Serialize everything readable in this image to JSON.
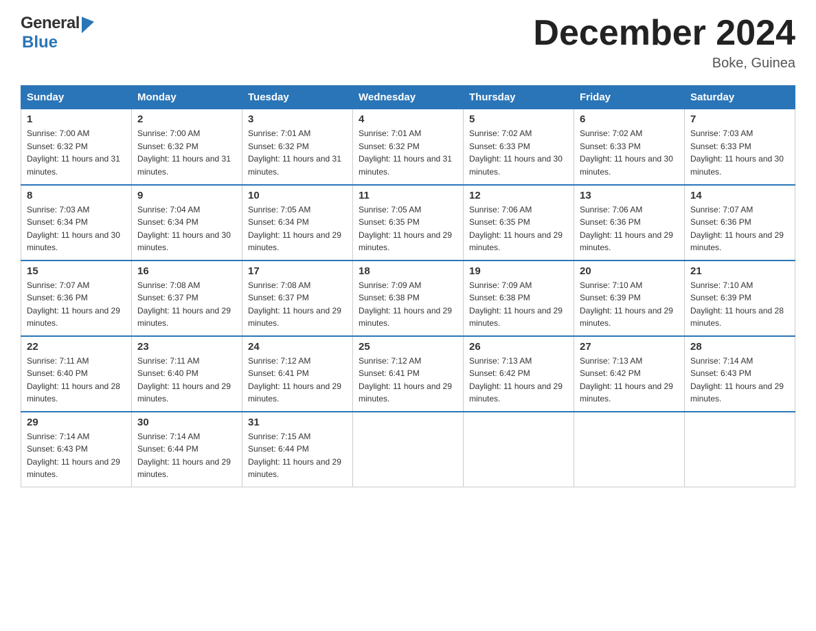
{
  "header": {
    "logo_general": "General",
    "logo_blue": "Blue",
    "month_title": "December 2024",
    "location": "Boke, Guinea"
  },
  "days_of_week": [
    "Sunday",
    "Monday",
    "Tuesday",
    "Wednesday",
    "Thursday",
    "Friday",
    "Saturday"
  ],
  "weeks": [
    [
      {
        "day": "1",
        "sunrise": "7:00 AM",
        "sunset": "6:32 PM",
        "daylight": "11 hours and 31 minutes."
      },
      {
        "day": "2",
        "sunrise": "7:00 AM",
        "sunset": "6:32 PM",
        "daylight": "11 hours and 31 minutes."
      },
      {
        "day": "3",
        "sunrise": "7:01 AM",
        "sunset": "6:32 PM",
        "daylight": "11 hours and 31 minutes."
      },
      {
        "day": "4",
        "sunrise": "7:01 AM",
        "sunset": "6:32 PM",
        "daylight": "11 hours and 31 minutes."
      },
      {
        "day": "5",
        "sunrise": "7:02 AM",
        "sunset": "6:33 PM",
        "daylight": "11 hours and 30 minutes."
      },
      {
        "day": "6",
        "sunrise": "7:02 AM",
        "sunset": "6:33 PM",
        "daylight": "11 hours and 30 minutes."
      },
      {
        "day": "7",
        "sunrise": "7:03 AM",
        "sunset": "6:33 PM",
        "daylight": "11 hours and 30 minutes."
      }
    ],
    [
      {
        "day": "8",
        "sunrise": "7:03 AM",
        "sunset": "6:34 PM",
        "daylight": "11 hours and 30 minutes."
      },
      {
        "day": "9",
        "sunrise": "7:04 AM",
        "sunset": "6:34 PM",
        "daylight": "11 hours and 30 minutes."
      },
      {
        "day": "10",
        "sunrise": "7:05 AM",
        "sunset": "6:34 PM",
        "daylight": "11 hours and 29 minutes."
      },
      {
        "day": "11",
        "sunrise": "7:05 AM",
        "sunset": "6:35 PM",
        "daylight": "11 hours and 29 minutes."
      },
      {
        "day": "12",
        "sunrise": "7:06 AM",
        "sunset": "6:35 PM",
        "daylight": "11 hours and 29 minutes."
      },
      {
        "day": "13",
        "sunrise": "7:06 AM",
        "sunset": "6:36 PM",
        "daylight": "11 hours and 29 minutes."
      },
      {
        "day": "14",
        "sunrise": "7:07 AM",
        "sunset": "6:36 PM",
        "daylight": "11 hours and 29 minutes."
      }
    ],
    [
      {
        "day": "15",
        "sunrise": "7:07 AM",
        "sunset": "6:36 PM",
        "daylight": "11 hours and 29 minutes."
      },
      {
        "day": "16",
        "sunrise": "7:08 AM",
        "sunset": "6:37 PM",
        "daylight": "11 hours and 29 minutes."
      },
      {
        "day": "17",
        "sunrise": "7:08 AM",
        "sunset": "6:37 PM",
        "daylight": "11 hours and 29 minutes."
      },
      {
        "day": "18",
        "sunrise": "7:09 AM",
        "sunset": "6:38 PM",
        "daylight": "11 hours and 29 minutes."
      },
      {
        "day": "19",
        "sunrise": "7:09 AM",
        "sunset": "6:38 PM",
        "daylight": "11 hours and 29 minutes."
      },
      {
        "day": "20",
        "sunrise": "7:10 AM",
        "sunset": "6:39 PM",
        "daylight": "11 hours and 29 minutes."
      },
      {
        "day": "21",
        "sunrise": "7:10 AM",
        "sunset": "6:39 PM",
        "daylight": "11 hours and 28 minutes."
      }
    ],
    [
      {
        "day": "22",
        "sunrise": "7:11 AM",
        "sunset": "6:40 PM",
        "daylight": "11 hours and 28 minutes."
      },
      {
        "day": "23",
        "sunrise": "7:11 AM",
        "sunset": "6:40 PM",
        "daylight": "11 hours and 29 minutes."
      },
      {
        "day": "24",
        "sunrise": "7:12 AM",
        "sunset": "6:41 PM",
        "daylight": "11 hours and 29 minutes."
      },
      {
        "day": "25",
        "sunrise": "7:12 AM",
        "sunset": "6:41 PM",
        "daylight": "11 hours and 29 minutes."
      },
      {
        "day": "26",
        "sunrise": "7:13 AM",
        "sunset": "6:42 PM",
        "daylight": "11 hours and 29 minutes."
      },
      {
        "day": "27",
        "sunrise": "7:13 AM",
        "sunset": "6:42 PM",
        "daylight": "11 hours and 29 minutes."
      },
      {
        "day": "28",
        "sunrise": "7:14 AM",
        "sunset": "6:43 PM",
        "daylight": "11 hours and 29 minutes."
      }
    ],
    [
      {
        "day": "29",
        "sunrise": "7:14 AM",
        "sunset": "6:43 PM",
        "daylight": "11 hours and 29 minutes."
      },
      {
        "day": "30",
        "sunrise": "7:14 AM",
        "sunset": "6:44 PM",
        "daylight": "11 hours and 29 minutes."
      },
      {
        "day": "31",
        "sunrise": "7:15 AM",
        "sunset": "6:44 PM",
        "daylight": "11 hours and 29 minutes."
      },
      {
        "day": "",
        "sunrise": "",
        "sunset": "",
        "daylight": ""
      },
      {
        "day": "",
        "sunrise": "",
        "sunset": "",
        "daylight": ""
      },
      {
        "day": "",
        "sunrise": "",
        "sunset": "",
        "daylight": ""
      },
      {
        "day": "",
        "sunrise": "",
        "sunset": "",
        "daylight": ""
      }
    ]
  ],
  "labels": {
    "sunrise_prefix": "Sunrise: ",
    "sunset_prefix": "Sunset: ",
    "daylight_prefix": "Daylight: "
  }
}
